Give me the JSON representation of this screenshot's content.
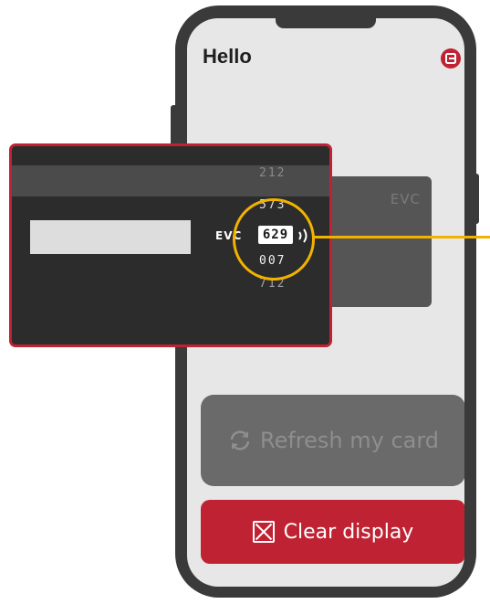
{
  "header": {
    "greeting": "Hello",
    "logout_icon": "logout-icon"
  },
  "phone_card": {
    "logo": "EVC"
  },
  "card_back": {
    "codes": [
      "212",
      "573",
      "007",
      "712"
    ],
    "brand": "EVC",
    "cvv": "629",
    "contactless_icon": "contactless-icon"
  },
  "buttons": {
    "refresh_label": "Refresh my card",
    "refresh_icon": "refresh-icon",
    "clear_label": "Clear display",
    "clear_icon": "close-box-icon"
  },
  "colors": {
    "accent": "#bf2232",
    "highlight": "#f2b200",
    "phone_frame": "#3a3a3a",
    "screen_bg": "#e7e7e7",
    "card_bg": "#2c2c2c"
  }
}
